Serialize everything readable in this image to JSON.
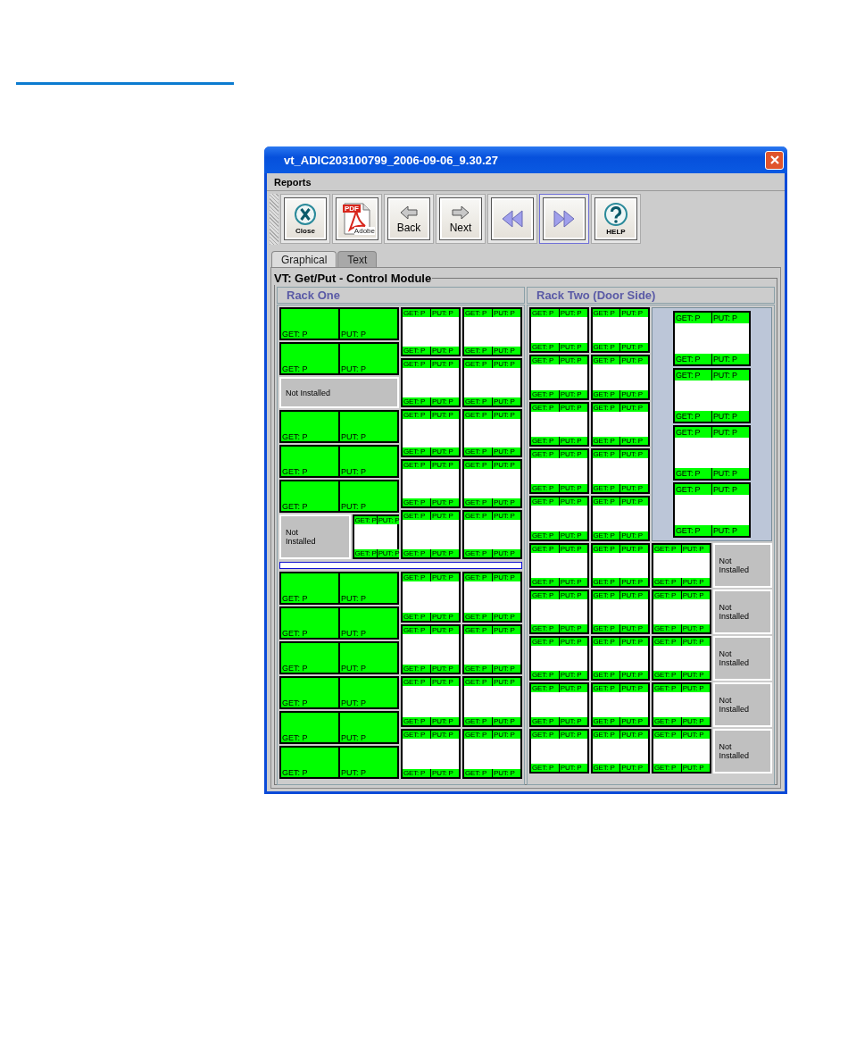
{
  "window": {
    "title": "vt_ADIC203100799_2006-09-06_9.30.27"
  },
  "menu": [
    {
      "label": "Reports"
    }
  ],
  "toolbar": [
    {
      "kind": "close",
      "label": "Close",
      "focused": false
    },
    {
      "kind": "pdf",
      "badge": "PDF",
      "label": "Adobe",
      "focused": false
    },
    {
      "kind": "back",
      "label": "Back",
      "focused": false
    },
    {
      "kind": "next",
      "label": "Next",
      "focused": false
    },
    {
      "kind": "rewind",
      "focused": false
    },
    {
      "kind": "forward",
      "focused": true
    },
    {
      "kind": "help",
      "label": "HELP",
      "focused": false
    }
  ],
  "tabs": [
    {
      "label": "Graphical",
      "selected": true
    },
    {
      "label": "Text",
      "selected": false
    }
  ],
  "group": {
    "title": "VT: Get/Put - Control Module"
  },
  "racks": [
    {
      "title": "Rack One",
      "sections": [
        {
          "kind": "bays",
          "columns": [
            {
              "kind": "stack",
              "items": [
                {
                  "kind": "drive",
                  "labels": [
                    "GET: P",
                    "PUT: P"
                  ]
                },
                {
                  "kind": "drive",
                  "labels": [
                    "GET: P",
                    "PUT: P"
                  ]
                },
                {
                  "kind": "empty",
                  "label": "Not Installed"
                },
                {
                  "kind": "drive",
                  "labels": [
                    "GET: P",
                    "PUT: P"
                  ]
                },
                {
                  "kind": "drive",
                  "labels": [
                    "GET: P",
                    "PUT: P"
                  ]
                },
                {
                  "kind": "drive",
                  "labels": [
                    "GET: P",
                    "PUT: P"
                  ]
                },
                {
                  "kind": "row",
                  "items": [
                    {
                      "kind": "empty",
                      "label": "Not Installed"
                    },
                    {
                      "kind": "magazine",
                      "top": [
                        "GET: P",
                        "PUT: P"
                      ],
                      "bottom": [
                        "GET: P",
                        "PUT: P"
                      ]
                    }
                  ]
                }
              ]
            },
            {
              "kind": "stack",
              "items": [
                {
                  "kind": "magazine",
                  "top": [
                    "GET: P",
                    "PUT: P"
                  ],
                  "bottom": [
                    "GET: P",
                    "PUT: P"
                  ]
                },
                {
                  "kind": "magazine",
                  "top": [
                    "GET: P",
                    "PUT: P"
                  ],
                  "bottom": [
                    "GET: P",
                    "PUT: P"
                  ]
                },
                {
                  "kind": "magazine",
                  "top": [
                    "GET: P",
                    "PUT: P"
                  ],
                  "bottom": [
                    "GET: P",
                    "PUT: P"
                  ]
                },
                {
                  "kind": "magazine",
                  "top": [
                    "GET: P",
                    "PUT: P"
                  ],
                  "bottom": [
                    "GET: P",
                    "PUT: P"
                  ]
                },
                {
                  "kind": "magazine",
                  "top": [
                    "GET: P",
                    "PUT: P"
                  ],
                  "bottom": [
                    "GET: P",
                    "PUT: P"
                  ]
                }
              ]
            },
            {
              "kind": "stack",
              "items": [
                {
                  "kind": "magazine",
                  "top": [
                    "GET: P",
                    "PUT: P"
                  ],
                  "bottom": [
                    "GET: P",
                    "PUT: P"
                  ]
                },
                {
                  "kind": "magazine",
                  "top": [
                    "GET: P",
                    "PUT: P"
                  ],
                  "bottom": [
                    "GET: P",
                    "PUT: P"
                  ]
                },
                {
                  "kind": "magazine",
                  "top": [
                    "GET: P",
                    "PUT: P"
                  ],
                  "bottom": [
                    "GET: P",
                    "PUT: P"
                  ]
                },
                {
                  "kind": "magazine",
                  "top": [
                    "GET: P",
                    "PUT: P"
                  ],
                  "bottom": [
                    "GET: P",
                    "PUT: P"
                  ]
                },
                {
                  "kind": "magazine",
                  "top": [
                    "GET: P",
                    "PUT: P"
                  ],
                  "bottom": [
                    "GET: P",
                    "PUT: P"
                  ]
                }
              ]
            }
          ]
        },
        {
          "kind": "divider"
        },
        {
          "kind": "bays",
          "columns": [
            {
              "kind": "stack",
              "items": [
                {
                  "kind": "drive",
                  "labels": [
                    "GET: P",
                    "PUT: P"
                  ]
                },
                {
                  "kind": "drive",
                  "labels": [
                    "GET: P",
                    "PUT: P"
                  ]
                },
                {
                  "kind": "drive",
                  "labels": [
                    "GET: P",
                    "PUT: P"
                  ]
                },
                {
                  "kind": "drive",
                  "labels": [
                    "GET: P",
                    "PUT: P"
                  ]
                },
                {
                  "kind": "drive",
                  "labels": [
                    "GET: P",
                    "PUT: P"
                  ]
                },
                {
                  "kind": "drive",
                  "labels": [
                    "GET: P",
                    "PUT: P"
                  ]
                }
              ]
            },
            {
              "kind": "stack",
              "items": [
                {
                  "kind": "magazine",
                  "top": [
                    "GET: P",
                    "PUT: P"
                  ],
                  "bottom": [
                    "GET: P",
                    "PUT: P"
                  ]
                },
                {
                  "kind": "magazine",
                  "top": [
                    "GET: P",
                    "PUT: P"
                  ],
                  "bottom": [
                    "GET: P",
                    "PUT: P"
                  ]
                },
                {
                  "kind": "magazine",
                  "top": [
                    "GET: P",
                    "PUT: P"
                  ],
                  "bottom": [
                    "GET: P",
                    "PUT: P"
                  ]
                },
                {
                  "kind": "magazine",
                  "top": [
                    "GET: P",
                    "PUT: P"
                  ],
                  "bottom": [
                    "GET: P",
                    "PUT: P"
                  ]
                }
              ]
            },
            {
              "kind": "stack",
              "items": [
                {
                  "kind": "magazine",
                  "top": [
                    "GET: P",
                    "PUT: P"
                  ],
                  "bottom": [
                    "GET: P",
                    "PUT: P"
                  ]
                },
                {
                  "kind": "magazine",
                  "top": [
                    "GET: P",
                    "PUT: P"
                  ],
                  "bottom": [
                    "GET: P",
                    "PUT: P"
                  ]
                },
                {
                  "kind": "magazine",
                  "top": [
                    "GET: P",
                    "PUT: P"
                  ],
                  "bottom": [
                    "GET: P",
                    "PUT: P"
                  ]
                },
                {
                  "kind": "magazine",
                  "top": [
                    "GET: P",
                    "PUT: P"
                  ],
                  "bottom": [
                    "GET: P",
                    "PUT: P"
                  ]
                }
              ]
            }
          ]
        }
      ]
    },
    {
      "title": "Rack Two (Door Side)",
      "sections": [
        {
          "kind": "bays",
          "columns": [
            {
              "kind": "stack",
              "items": [
                {
                  "kind": "magazine",
                  "top": [
                    "GET: P",
                    "PUT: P"
                  ],
                  "bottom": [
                    "GET: P",
                    "PUT: P"
                  ]
                },
                {
                  "kind": "magazine",
                  "top": [
                    "GET: P",
                    "PUT: P"
                  ],
                  "bottom": [
                    "GET: P",
                    "PUT: P"
                  ]
                },
                {
                  "kind": "magazine",
                  "top": [
                    "GET: P",
                    "PUT: P"
                  ],
                  "bottom": [
                    "GET: P",
                    "PUT: P"
                  ]
                },
                {
                  "kind": "magazine",
                  "top": [
                    "GET: P",
                    "PUT: P"
                  ],
                  "bottom": [
                    "GET: P",
                    "PUT: P"
                  ]
                },
                {
                  "kind": "magazine",
                  "top": [
                    "GET: P",
                    "PUT: P"
                  ],
                  "bottom": [
                    "GET: P",
                    "PUT: P"
                  ]
                }
              ]
            },
            {
              "kind": "stack",
              "items": [
                {
                  "kind": "magazine",
                  "top": [
                    "GET: P",
                    "PUT: P"
                  ],
                  "bottom": [
                    "GET: P",
                    "PUT: P"
                  ]
                },
                {
                  "kind": "magazine",
                  "top": [
                    "GET: P",
                    "PUT: P"
                  ],
                  "bottom": [
                    "GET: P",
                    "PUT: P"
                  ]
                },
                {
                  "kind": "magazine",
                  "top": [
                    "GET: P",
                    "PUT: P"
                  ],
                  "bottom": [
                    "GET: P",
                    "PUT: P"
                  ]
                },
                {
                  "kind": "magazine",
                  "top": [
                    "GET: P",
                    "PUT: P"
                  ],
                  "bottom": [
                    "GET: P",
                    "PUT: P"
                  ]
                },
                {
                  "kind": "magazine",
                  "top": [
                    "GET: P",
                    "PUT: P"
                  ],
                  "bottom": [
                    "GET: P",
                    "PUT: P"
                  ]
                }
              ]
            },
            {
              "kind": "panel",
              "items": [
                {
                  "kind": "magazine",
                  "top": [
                    "GET: P",
                    "PUT: P"
                  ],
                  "bottom": [
                    "GET: P",
                    "PUT: P"
                  ]
                },
                {
                  "kind": "magazine",
                  "top": [
                    "GET: P",
                    "PUT: P"
                  ],
                  "bottom": [
                    "GET: P",
                    "PUT: P"
                  ]
                },
                {
                  "kind": "magazine",
                  "top": [
                    "GET: P",
                    "PUT: P"
                  ],
                  "bottom": [
                    "GET: P",
                    "PUT: P"
                  ]
                },
                {
                  "kind": "magazine",
                  "top": [
                    "GET: P",
                    "PUT: P"
                  ],
                  "bottom": [
                    "GET: P",
                    "PUT: P"
                  ]
                }
              ]
            }
          ]
        },
        {
          "kind": "bays",
          "columns": [
            {
              "kind": "stack",
              "items": [
                {
                  "kind": "magazine",
                  "top": [
                    "GET: P",
                    "PUT: P"
                  ],
                  "bottom": [
                    "GET: P",
                    "PUT: P"
                  ]
                },
                {
                  "kind": "magazine",
                  "top": [
                    "GET: P",
                    "PUT: P"
                  ],
                  "bottom": [
                    "GET: P",
                    "PUT: P"
                  ]
                },
                {
                  "kind": "magazine",
                  "top": [
                    "GET: P",
                    "PUT: P"
                  ],
                  "bottom": [
                    "GET: P",
                    "PUT: P"
                  ]
                },
                {
                  "kind": "magazine",
                  "top": [
                    "GET: P",
                    "PUT: P"
                  ],
                  "bottom": [
                    "GET: P",
                    "PUT: P"
                  ]
                },
                {
                  "kind": "magazine",
                  "top": [
                    "GET: P",
                    "PUT: P"
                  ],
                  "bottom": [
                    "GET: P",
                    "PUT: P"
                  ]
                }
              ]
            },
            {
              "kind": "stack",
              "items": [
                {
                  "kind": "magazine",
                  "top": [
                    "GET: P",
                    "PUT: P"
                  ],
                  "bottom": [
                    "GET: P",
                    "PUT: P"
                  ]
                },
                {
                  "kind": "magazine",
                  "top": [
                    "GET: P",
                    "PUT: P"
                  ],
                  "bottom": [
                    "GET: P",
                    "PUT: P"
                  ]
                },
                {
                  "kind": "magazine",
                  "top": [
                    "GET: P",
                    "PUT: P"
                  ],
                  "bottom": [
                    "GET: P",
                    "PUT: P"
                  ]
                },
                {
                  "kind": "magazine",
                  "top": [
                    "GET: P",
                    "PUT: P"
                  ],
                  "bottom": [
                    "GET: P",
                    "PUT: P"
                  ]
                },
                {
                  "kind": "magazine",
                  "top": [
                    "GET: P",
                    "PUT: P"
                  ],
                  "bottom": [
                    "GET: P",
                    "PUT: P"
                  ]
                }
              ]
            },
            {
              "kind": "stack",
              "items": [
                {
                  "kind": "magazine",
                  "top": [
                    "GET: P",
                    "PUT: P"
                  ],
                  "bottom": [
                    "GET: P",
                    "PUT: P"
                  ]
                },
                {
                  "kind": "magazine",
                  "top": [
                    "GET: P",
                    "PUT: P"
                  ],
                  "bottom": [
                    "GET: P",
                    "PUT: P"
                  ]
                },
                {
                  "kind": "magazine",
                  "top": [
                    "GET: P",
                    "PUT: P"
                  ],
                  "bottom": [
                    "GET: P",
                    "PUT: P"
                  ]
                },
                {
                  "kind": "magazine",
                  "top": [
                    "GET: P",
                    "PUT: P"
                  ],
                  "bottom": [
                    "GET: P",
                    "PUT: P"
                  ]
                },
                {
                  "kind": "magazine",
                  "top": [
                    "GET: P",
                    "PUT: P"
                  ],
                  "bottom": [
                    "GET: P",
                    "PUT: P"
                  ]
                }
              ]
            },
            {
              "kind": "stack",
              "items": [
                {
                  "kind": "empty",
                  "label": "Not Installed"
                },
                {
                  "kind": "empty",
                  "label": "Not Installed"
                },
                {
                  "kind": "empty",
                  "label": "Not Installed"
                },
                {
                  "kind": "empty",
                  "label": "Not Installed"
                },
                {
                  "kind": "empty",
                  "label": "Not Installed"
                }
              ]
            }
          ]
        }
      ]
    }
  ]
}
